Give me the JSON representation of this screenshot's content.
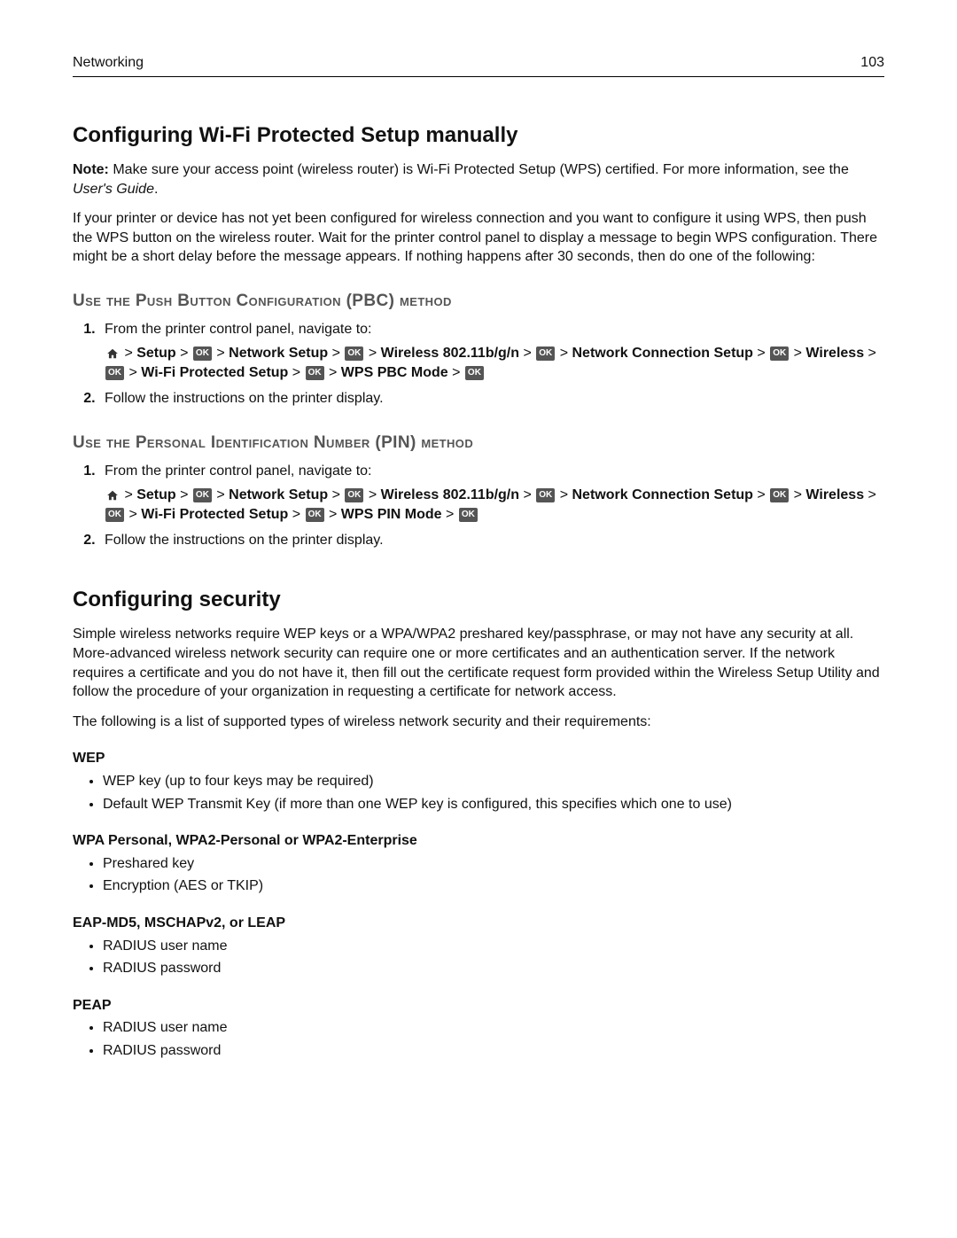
{
  "header": {
    "section": "Networking",
    "page": "103"
  },
  "h1_wps": "Configuring Wi‑Fi Protected Setup manually",
  "note": {
    "label": "Note:",
    "text": " Make sure your access point (wireless router) is Wi‑Fi Protected Setup (WPS) certified. For more information, see the ",
    "guide": "User's Guide",
    "period": "."
  },
  "intro_wps": "If your printer or device has not yet been configured for wireless connection and you want to configure it using WPS, then push the WPS button on the wireless router. Wait for the printer control panel to display a message to begin WPS configuration. There might be a short delay before the message appears. If nothing happens after 30 seconds, then do one of the following:",
  "pbc": {
    "title": "Use the Push Button Configuration (PBC) method",
    "step1": "From the printer control panel, navigate to:",
    "step2": "Follow the instructions on the printer display.",
    "path": {
      "setup": "Setup",
      "network_setup": "Network Setup",
      "wireless_std": "Wireless 802.11b/g/n",
      "conn_setup": "Network Connection Setup",
      "wireless": "Wireless",
      "wifi_protected": "Wi‑Fi Protected Setup",
      "mode": "WPS PBC Mode",
      "ok": "OK"
    }
  },
  "pin": {
    "title": "Use the Personal Identification Number (PIN) method",
    "step1": "From the printer control panel, navigate to:",
    "step2": "Follow the instructions on the printer display.",
    "path": {
      "setup": "Setup",
      "network_setup": "Network Setup",
      "wireless_std": "Wireless 802.11b/g/n",
      "conn_setup": "Network Connection Setup",
      "wireless": "Wireless",
      "wifi_protected": "Wi‑Fi Protected Setup",
      "mode": "WPS PIN Mode",
      "ok": "OK"
    }
  },
  "h1_sec": "Configuring security",
  "sec_intro": "Simple wireless networks require WEP keys or a WPA/WPA2 preshared key/passphrase, or may not have any security at all. More-advanced wireless network security can require one or more certificates and an authentication server. If the network requires a certificate and you do not have it, then fill out the certificate request form provided within the Wireless Setup Utility and follow the procedure of your organization in requesting a certificate for network access.",
  "sec_following": "The following is a list of supported types of wireless network security and their requirements:",
  "wep": {
    "title": "WEP",
    "i1": "WEP key (up to four keys may be required)",
    "i2": "Default WEP Transmit Key (if more than one WEP key is configured, this specifies which one to use)"
  },
  "wpa": {
    "title": "WPA Personal, WPA2‑Personal or WPA2‑Enterprise",
    "i1": "Preshared key",
    "i2": "Encryption (AES or TKIP)"
  },
  "eap": {
    "title": "EAP‑MD5, MSCHAPv2, or LEAP",
    "i1": "RADIUS user name",
    "i2": "RADIUS password"
  },
  "peap": {
    "title": "PEAP",
    "i1": "RADIUS user name",
    "i2": "RADIUS password"
  }
}
